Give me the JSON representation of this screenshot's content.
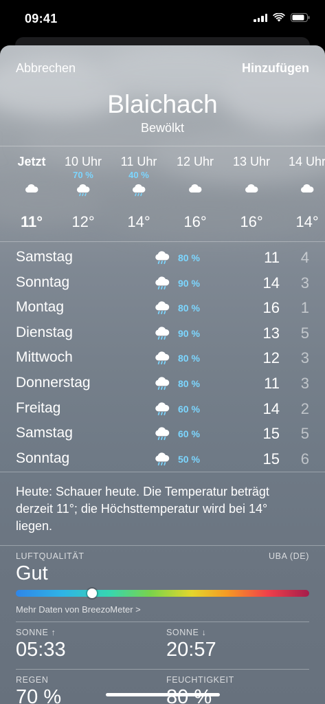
{
  "status_bar": {
    "time": "09:41"
  },
  "header": {
    "cancel_label": "Abbrechen",
    "add_label": "Hinzufügen",
    "city": "Blaichach",
    "condition": "Bewölkt"
  },
  "hourly": [
    {
      "label": "Jetzt",
      "pop": "",
      "icon": "cloud-icon",
      "temp": "11°"
    },
    {
      "label": "10 Uhr",
      "pop": "70 %",
      "icon": "cloud-rain-icon",
      "temp": "12°"
    },
    {
      "label": "11 Uhr",
      "pop": "40 %",
      "icon": "cloud-rain-icon",
      "temp": "14°"
    },
    {
      "label": "12 Uhr",
      "pop": "",
      "icon": "cloud-icon",
      "temp": "16°"
    },
    {
      "label": "13 Uhr",
      "pop": "",
      "icon": "cloud-icon",
      "temp": "16°"
    },
    {
      "label": "14 Uhr",
      "pop": "",
      "icon": "cloud-icon",
      "temp": "14°"
    }
  ],
  "daily": [
    {
      "day": "Samstag",
      "icon": "cloud-rain-icon",
      "pop": "80 %",
      "high": "11",
      "low": "4"
    },
    {
      "day": "Sonntag",
      "icon": "cloud-rain-icon",
      "pop": "90 %",
      "high": "14",
      "low": "3"
    },
    {
      "day": "Montag",
      "icon": "cloud-rain-icon",
      "pop": "80 %",
      "high": "16",
      "low": "1"
    },
    {
      "day": "Dienstag",
      "icon": "cloud-rain-icon",
      "pop": "90 %",
      "high": "13",
      "low": "5"
    },
    {
      "day": "Mittwoch",
      "icon": "cloud-rain-icon",
      "pop": "80 %",
      "high": "12",
      "low": "3"
    },
    {
      "day": "Donnerstag",
      "icon": "cloud-rain-icon",
      "pop": "80 %",
      "high": "11",
      "low": "3"
    },
    {
      "day": "Freitag",
      "icon": "cloud-rain-icon",
      "pop": "60 %",
      "high": "14",
      "low": "2"
    },
    {
      "day": "Samstag",
      "icon": "cloud-rain-icon",
      "pop": "60 %",
      "high": "15",
      "low": "5"
    },
    {
      "day": "Sonntag",
      "icon": "cloud-rain-icon",
      "pop": "50 %",
      "high": "15",
      "low": "6"
    }
  ],
  "summary": "Heute: Schauer heute. Die Temperatur beträgt derzeit 11°; die Höchsttemperatur wird bei 14° liegen.",
  "air_quality": {
    "label": "LUFTQUALITÄT",
    "source": "UBA (DE)",
    "value": "Gut",
    "level_fraction": 0.26,
    "more_link": "Mehr Daten von BreezoMeter >"
  },
  "details": {
    "sunrise_label": "SONNE ↑",
    "sunrise_value": "05:33",
    "sunset_label": "SONNE ↓",
    "sunset_value": "20:57",
    "rain_label": "REGEN",
    "rain_value": "70 %",
    "humidity_label": "FEUCHTIGKEIT",
    "humidity_value": "80 %"
  },
  "colors": {
    "precip_accent": "#7cd6ff"
  }
}
